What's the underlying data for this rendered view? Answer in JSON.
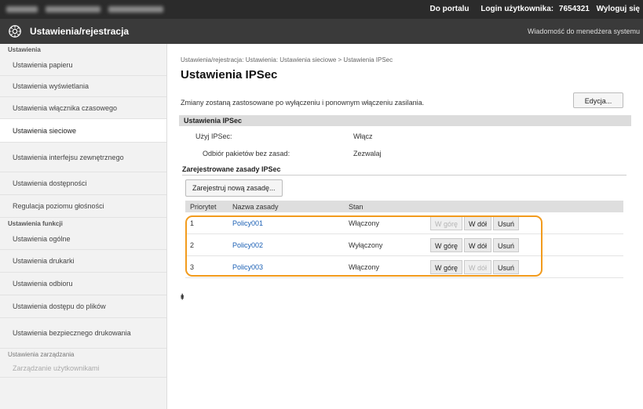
{
  "topbar": {
    "portal_link": "Do portalu",
    "login_label": "Login użytkownika:",
    "user_id": "7654321",
    "logout_link": "Wyloguj się"
  },
  "header": {
    "title": "Ustawienia/rejestracja",
    "message_link": "Wiadomość do menedżera systemu"
  },
  "sidebar": {
    "group1": "Ustawienia",
    "items1": [
      "Ustawienia papieru",
      "Ustawienia wyświetlania",
      "Ustawienia włącznika czasowego",
      "Ustawienia sieciowe",
      "Ustawienia interfejsu zewnętrznego",
      "Ustawienia dostępności",
      "Regulacja poziomu głośności"
    ],
    "group2": "Ustawienia funkcji",
    "items2": [
      "Ustawienia ogólne",
      "Ustawienia drukarki",
      "Ustawienia odbioru",
      "Ustawienia dostępu do plików",
      "Ustawienia bezpiecznego drukowania"
    ],
    "group3": "Ustawienia zarządzania",
    "items3": [
      "Zarządzanie użytkownikami"
    ]
  },
  "main": {
    "breadcrumb": "Ustawienia/rejestracja: Ustawienia: Ustawienia sieciowe > Ustawienia IPSec",
    "title": "Ustawienia IPSec",
    "notice": "Zmiany zostaną zastosowane po wyłączeniu i ponownym włączeniu zasilania.",
    "edit_button": "Edycja...",
    "section_title": "Ustawienia IPSec",
    "use_ipsec_label": "Użyj IPSec:",
    "use_ipsec_value": "Włącz",
    "receive_label": "Odbiór pakietów bez zasad:",
    "receive_value": "Zezwalaj",
    "registered_title": "Zarejestrowane zasady IPSec",
    "register_button": "Zarejestruj nową zasadę...",
    "table": {
      "headers": [
        "Priorytet",
        "Nazwa zasady",
        "Stan"
      ],
      "rows": [
        {
          "priority": "1",
          "name": "Policy001",
          "state": "Włączony"
        },
        {
          "priority": "2",
          "name": "Policy002",
          "state": "Wyłączony"
        },
        {
          "priority": "3",
          "name": "Policy003",
          "state": "Włączony"
        }
      ],
      "btn_up": "W górę",
      "btn_down": "W dół",
      "btn_delete": "Usuń"
    },
    "to_top": "⯒"
  },
  "colors": {
    "highlight": "#f29b1d",
    "link": "#1a5fb4",
    "topbar": "#2b2b2b",
    "header": "#3a3a3a"
  }
}
